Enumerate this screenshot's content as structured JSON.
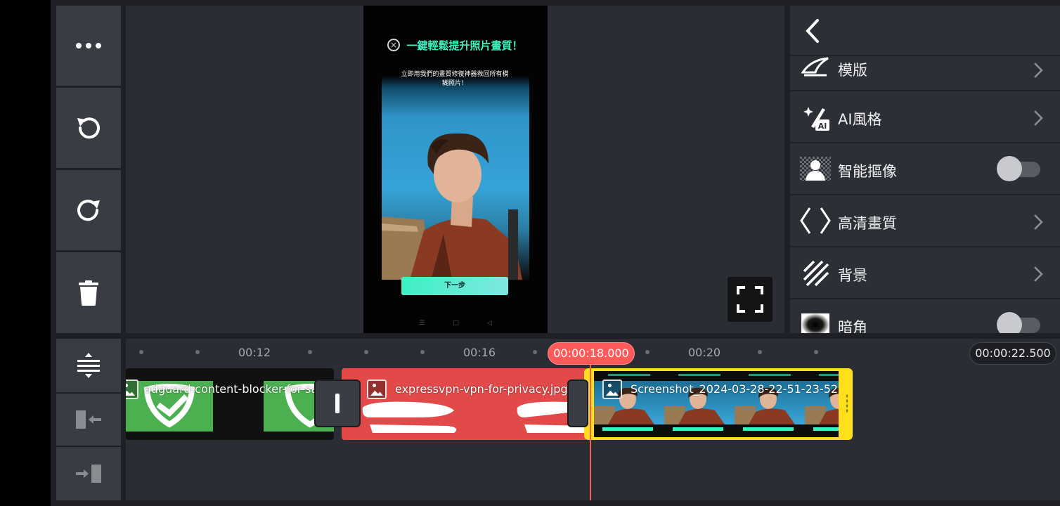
{
  "toolbar": {
    "more_icon": "more-horizontal-icon",
    "undo_icon": "undo-icon",
    "redo_icon": "redo-icon",
    "delete_icon": "trash-icon"
  },
  "preview": {
    "phone_title": "一鍵輕鬆提升照片畫質！",
    "phone_subtitle": "立即用我們的畫質修復神器救回所有模糊照片！",
    "phone_button": "下一步",
    "phone_nav": [
      "☰",
      "□",
      "◁"
    ],
    "fullscreen_icon": "fullscreen-icon"
  },
  "panel": {
    "back_icon": "chevron-left-icon",
    "rows": [
      {
        "label": "模版",
        "icon": "template-icon",
        "control": "chevron"
      },
      {
        "label": "AI風格",
        "icon": "ai-style-icon",
        "control": "chevron"
      },
      {
        "label": "智能摳像",
        "icon": "cutout-icon",
        "control": "toggle",
        "on": false
      },
      {
        "label": "高清畫質",
        "icon": "hd-quality-icon",
        "control": "chevron"
      },
      {
        "label": "背景",
        "icon": "background-icon",
        "control": "chevron"
      },
      {
        "label": "暗角",
        "icon": "vignette-icon",
        "control": "toggle",
        "on": false
      }
    ]
  },
  "timeline": {
    "ticks": [
      "00:12",
      "00:16",
      "00:20"
    ],
    "playhead_time": "00:00:18.000",
    "total_time": "00:00:22.500",
    "clips": [
      {
        "name": "adguard-content-blocker-for-sa",
        "color": "#4cb050"
      },
      {
        "name": "expressvpn-vpn-for-privacy.jpg",
        "color": "#e24a4a"
      },
      {
        "name": "Screenshot_2024-03-28-22-51-23-52",
        "color": "#ffe01a"
      }
    ],
    "tools": {
      "split_icon": "track-height-icon",
      "trim_left_icon": "trim-left-icon",
      "trim_right_icon": "trim-right-icon"
    }
  },
  "colors": {
    "accent": "#ff5a5a",
    "selected_clip": "#ffe01a",
    "panel_bg": "#2b2d34"
  }
}
